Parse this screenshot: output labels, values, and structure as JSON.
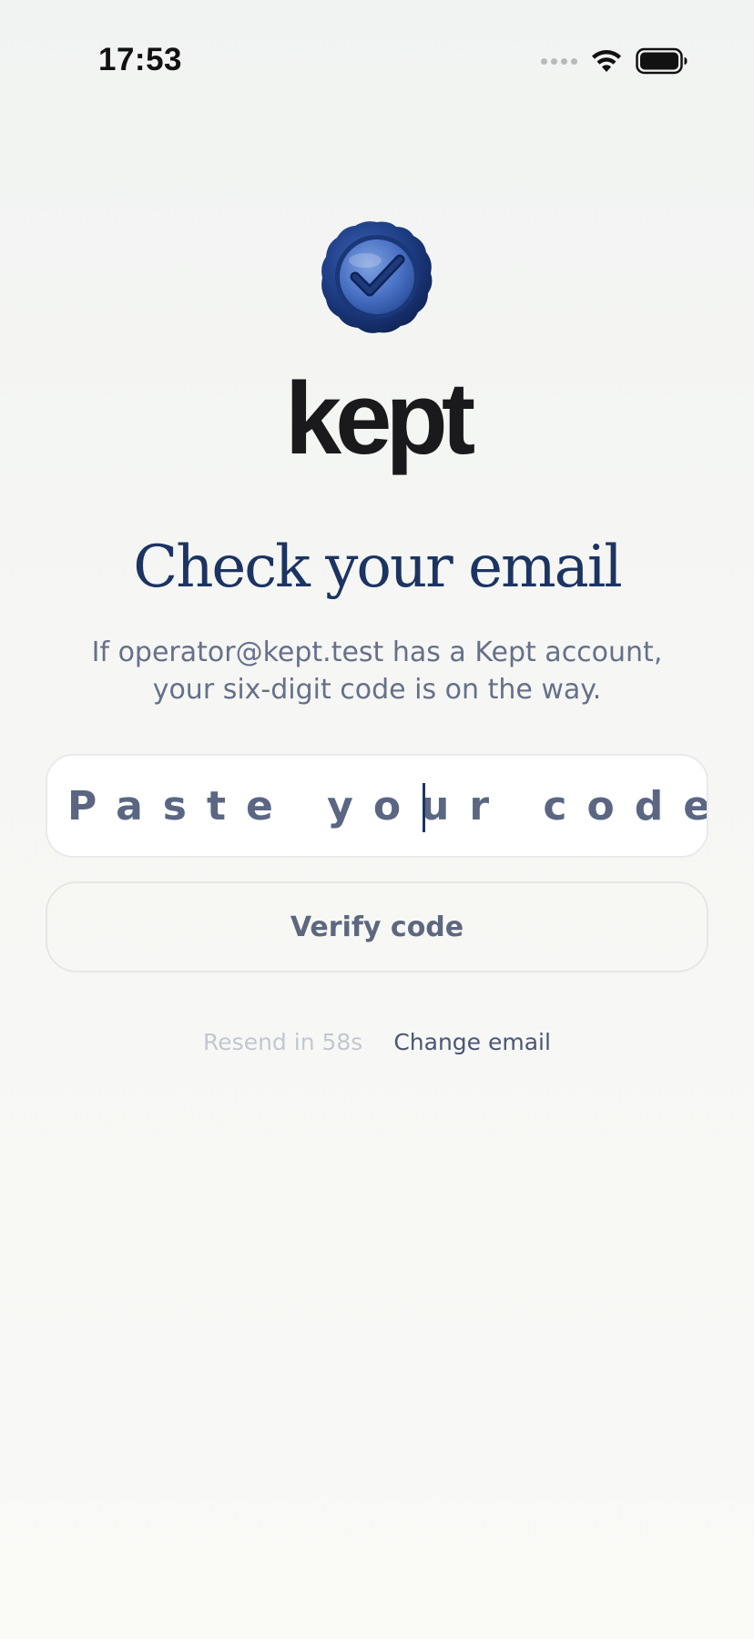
{
  "status_bar": {
    "time": "17:53",
    "icons": [
      "cellular-signal-icon",
      "wifi-icon",
      "battery-icon"
    ]
  },
  "brand": {
    "logo_icon": "wax-seal-check-icon",
    "wordmark": "kept",
    "colors": {
      "navy": "#1c3462",
      "seal_blue": "#24478f",
      "wordmark": "#1a1a1c"
    }
  },
  "main": {
    "headline": "Check your email",
    "subtitle_line1": "If operator@kept.test has a Kept account,",
    "subtitle_line2": "your six-digit code is on the way.",
    "code_input": {
      "placeholder": "Paste your code",
      "value": ""
    },
    "verify_label": "Verify code",
    "resend_label": "Resend in 58s",
    "change_email_label": "Change email"
  }
}
